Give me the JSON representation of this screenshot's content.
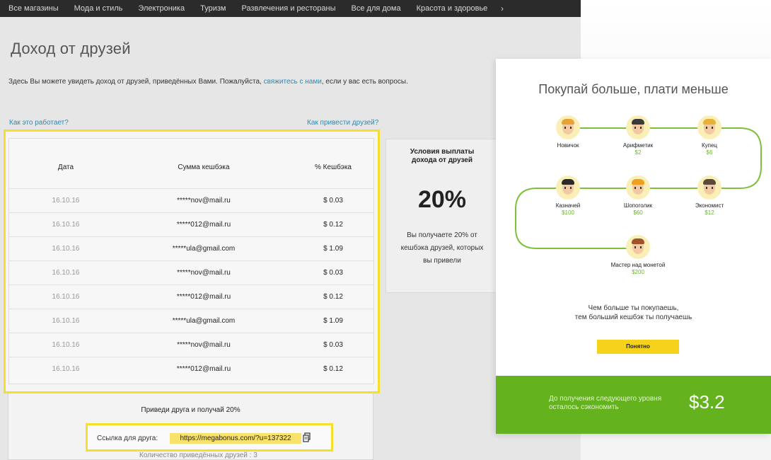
{
  "nav": {
    "items": [
      "Все магазины",
      "Мода и стиль",
      "Электроника",
      "Туризм",
      "Развлечения и рестораны",
      "Все для дома",
      "Красота и здоровье"
    ],
    "arrow": "›"
  },
  "page": {
    "title": "Доход от друзей",
    "intro_before": "Здесь Вы можете увидеть доход от друзей, приведённых Вами. Пожалуйста, ",
    "intro_link": "свяжитесь с нами",
    "intro_after": ", если у вас есть вопросы.",
    "how_it_works": "Как это работает?",
    "how_to_invite": "Как привести друзей?"
  },
  "conditions": {
    "title": "Условия выплаты дохода от друзей",
    "percent": "20%",
    "text": "Вы получаете 20% от кешбэка друзей, которых вы привели"
  },
  "table": {
    "headers": [
      "Дата",
      "Сумма кешбэка",
      "% Кешбэка"
    ],
    "rows": [
      {
        "date": "16.10.16",
        "email": "*****nov@mail.ru",
        "amount": "$ 0.03"
      },
      {
        "date": "16.10.16",
        "email": "*****012@mail.ru",
        "amount": "$ 0.12"
      },
      {
        "date": "16.10.16",
        "email": "*****ula@gmail.com",
        "amount": "$ 1.09"
      },
      {
        "date": "16.10.16",
        "email": "*****nov@mail.ru",
        "amount": "$ 0.03"
      },
      {
        "date": "16.10.16",
        "email": "*****012@mail.ru",
        "amount": "$ 0.12"
      },
      {
        "date": "16.10.16",
        "email": "*****ula@gmail.com",
        "amount": "$ 1.09"
      },
      {
        "date": "16.10.16",
        "email": "*****nov@mail.ru",
        "amount": "$ 0.03"
      },
      {
        "date": "16.10.16",
        "email": "*****012@mail.ru",
        "amount": "$ 0.12"
      }
    ]
  },
  "invite": {
    "title": "Приведи друга и получай 20%",
    "link_label": "Ссылка для друга:",
    "link_value": "https://megabonus.com/?u=137322",
    "friends_count": "Количество приведённых друзей : 3"
  },
  "modal": {
    "title": "Покупай больше, плати меньше",
    "levels": [
      {
        "name": "Новичок",
        "amount": "",
        "hair": "#e8a23a"
      },
      {
        "name": "Арифметик",
        "amount": "$2",
        "hair": "#3a3a3a"
      },
      {
        "name": "Купец",
        "amount": "$6",
        "hair": "#e8b23a"
      },
      {
        "name": "Казначей",
        "amount": "$100",
        "hair": "#2a2a2a"
      },
      {
        "name": "Шопоголик",
        "amount": "$60",
        "hair": "#f0a020"
      },
      {
        "name": "Экономист",
        "amount": "$12",
        "hair": "#5a4a3a"
      },
      {
        "name": "Мастер над монетой",
        "amount": "$200",
        "hair": "#a0522d"
      }
    ],
    "desc_line1": "Чем больше ты покупаешь,",
    "desc_line2": "тем больший кешбэк ты получаешь",
    "ok_button": "Понятно",
    "footer_line1": "До получения следующего уровня",
    "footer_line2": "осталось сэкономить",
    "footer_amount": "$3.2",
    "accent": "#64b21e",
    "button_color": "#f7d21b"
  }
}
